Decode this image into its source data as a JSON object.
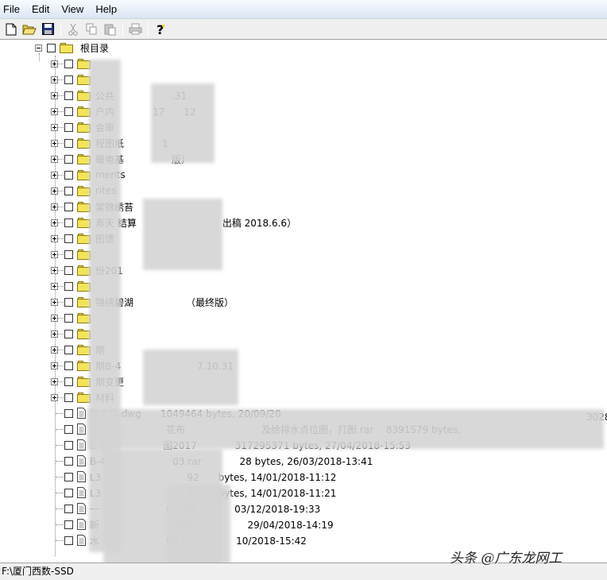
{
  "menu": [
    "File",
    "Edit",
    "View",
    "Help"
  ],
  "toolbar": {
    "buttons": [
      "new-icon",
      "open-icon",
      "save-icon",
      "cut-icon",
      "copy-icon",
      "paste-icon",
      "print-icon",
      "help-icon"
    ]
  },
  "tree": {
    "root_label": "根目录",
    "folders": [
      "",
      "",
      "公共　　　　　　.31",
      "户内　　　　17　　12",
      "会审",
      "程图纸　　　　1",
      "暖电基　　　　　版）",
      "ments",
      "rites",
      "棠锦绣苔",
      "寿天 结算　　　　　　　　　出稿 2018.6.6）",
      "图馈",
      "",
      "份201",
      "",
      "锦绣碧湖　　　　　　（最终版）",
      "",
      "",
      "期",
      "期B-4　　　　　　　　7.10.31",
      "期变更",
      "材料"
    ],
    "files": [
      "施工图.dwg　　1049464 bytes, 20/09/20",
      "工图　　　　　　花布　　　　　　　　及给排水点位图，打图.rar　 8391579 bytes,",
      "B-4　　　　　　图2017　　　　317295371 bytes, 27/04/2018-15:53",
      "B-4　　　　　　　03.rar　　　　28 bytes, 26/03/2018-13:41",
      "L3　　　　　　　　　92　　bytes, 14/01/2018-11:12",
      "L3　　　　　　　　　95　　bytes, 14/01/2018-11:21",
      "一　　　　　　　63098　　　　03/12/2018-19:33",
      "新　　　　　　　　4421　　　　　29/04/2018-14:19",
      "水　　　　　　　64 bytes　　　10/2018-15:42"
    ],
    "right_cutoff": "3028"
  },
  "status": {
    "path": "F:\\厦门西数-SSD"
  },
  "watermark": "头条 @广东龙网工"
}
